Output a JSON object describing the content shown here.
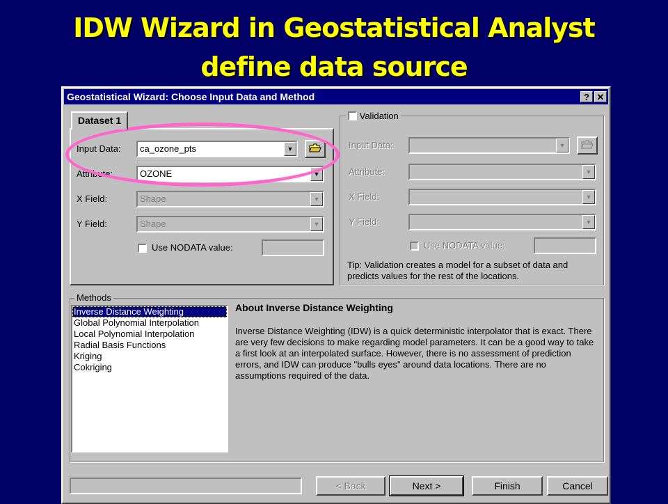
{
  "slide": {
    "title_line1": "IDW Wizard in Geostatistical Analyst",
    "title_line2": "define data source"
  },
  "window": {
    "title": "Geostatistical Wizard: Choose Input Data and Method",
    "help_button": "?",
    "close_button": "✕"
  },
  "dataset_tab": {
    "label": "Dataset 1",
    "input_data_label": "Input Data:",
    "input_data_value": "ca_ozone_pts",
    "attribute_label": "Attribute:",
    "attribute_value": "OZONE",
    "x_field_label": "X Field:",
    "x_field_value": "Shape",
    "y_field_label": "Y Field:",
    "y_field_value": "Shape",
    "nodata_label": "Use NODATA value:"
  },
  "validation": {
    "label": "Validation",
    "input_data_label": "Input Data:",
    "attribute_label": "Attribute:",
    "x_field_label": "X Field:",
    "y_field_label": "Y Field:",
    "nodata_label": "Use NODATA value:",
    "tip": "Tip:  Validation creates a model for a subset of data and predicts values for the rest of the locations."
  },
  "methods": {
    "label": "Methods",
    "items": [
      "Inverse Distance Weighting",
      "Global Polynomial Interpolation",
      "Local Polynomial Interpolation",
      "Radial Basis Functions",
      "Kriging",
      "Cokriging"
    ],
    "selected_index": 0,
    "about_title": "About Inverse Distance Weighting",
    "about_text": "Inverse Distance Weighting (IDW) is a quick deterministic interpolator that is exact. There are very few decisions to make regarding model parameters. It can be a good way to take a first look at an interpolated surface. However, there is no assessment of prediction errors, and IDW can produce \"bulls eyes\" around data locations. There are no assumptions required of the data."
  },
  "footer": {
    "back": "< Back",
    "next": "Next >",
    "finish": "Finish",
    "cancel": "Cancel"
  },
  "icons": {
    "folder": "open-folder-icon",
    "dropdown": "chevron-down-icon"
  },
  "colors": {
    "background": "#000066",
    "title_text": "#ffff00",
    "highlight_ellipse": "#ff66cc",
    "titlebar": "#000080"
  }
}
